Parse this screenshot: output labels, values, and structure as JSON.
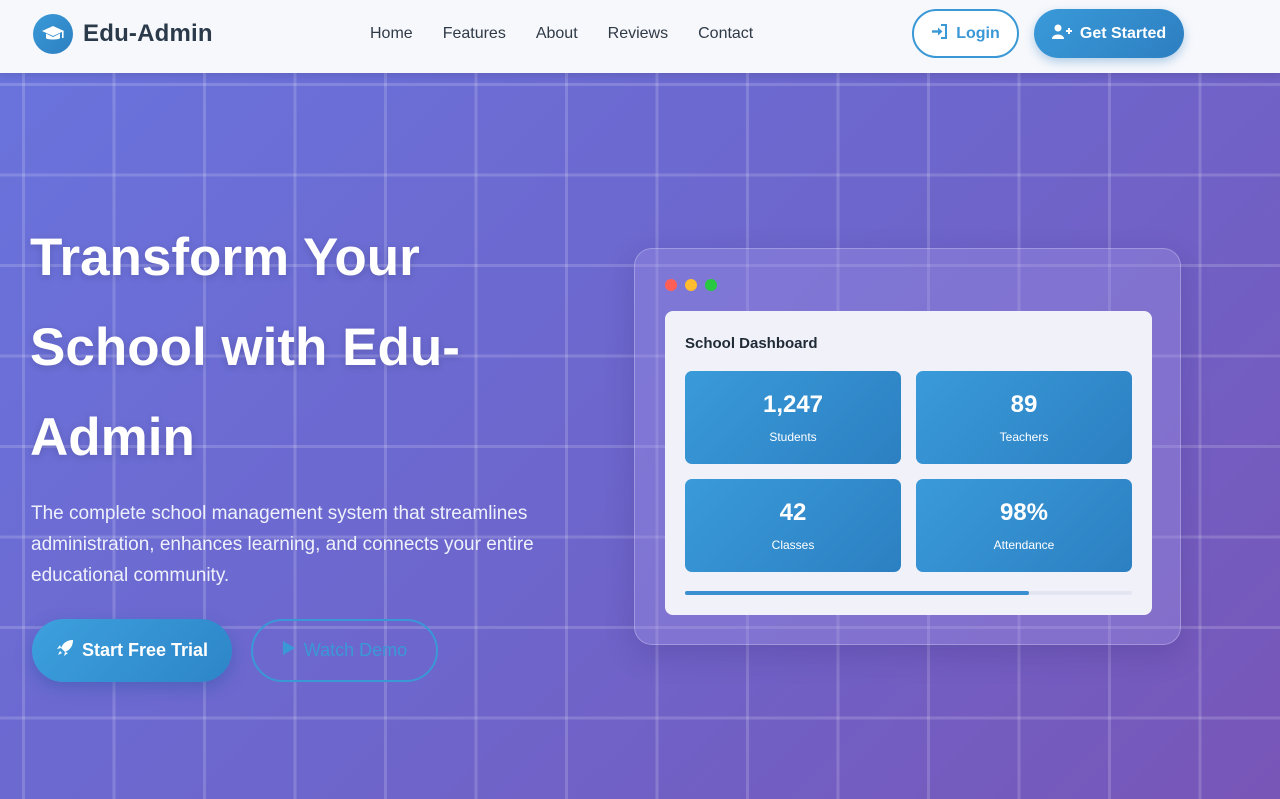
{
  "brand": {
    "name": "Edu-Admin",
    "icon": "graduation-cap-icon"
  },
  "nav": {
    "links": [
      "Home",
      "Features",
      "About",
      "Reviews",
      "Contact"
    ]
  },
  "auth": {
    "login_label": "Login",
    "login_icon": "sign-in-icon",
    "get_started_label": "Get Started",
    "get_started_icon": "user-plus-icon"
  },
  "hero": {
    "title": "Transform Your School with Edu-Admin",
    "subtitle": "The complete school management system that streamlines administration, enhances learning, and connects your entire educational community.",
    "primary_cta": "Start Free Trial",
    "primary_cta_icon": "rocket-icon",
    "secondary_cta": "Watch Demo",
    "secondary_cta_icon": "play-icon"
  },
  "dashboard": {
    "title": "School Dashboard",
    "window_dots": [
      "#ff5f57",
      "#febc2e",
      "#28c840"
    ],
    "stats": [
      {
        "value": "1,247",
        "label": "Students"
      },
      {
        "value": "89",
        "label": "Teachers"
      },
      {
        "value": "42",
        "label": "Classes"
      },
      {
        "value": "98%",
        "label": "Attendance"
      }
    ],
    "progress_fraction": 0.77
  },
  "colors": {
    "accent": "#3a98d6",
    "hero_start": "#6a73dc",
    "hero_end": "#7856b8",
    "nav_bg": "#f7f8fc"
  }
}
